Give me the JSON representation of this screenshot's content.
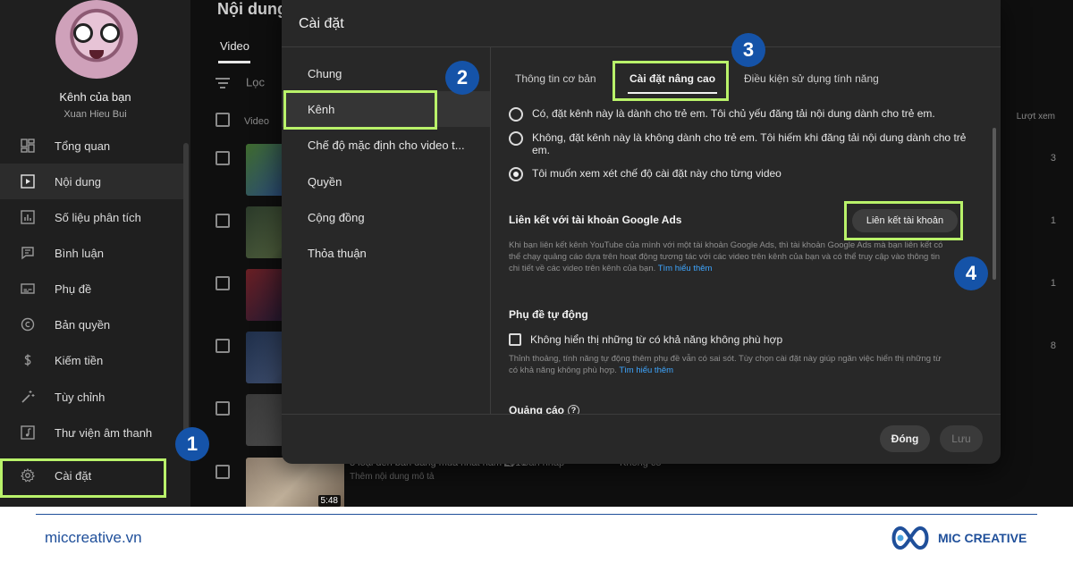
{
  "sidebar": {
    "channel_name": "Kênh của bạn",
    "channel_handle": "Xuan Hieu Bui",
    "items": [
      {
        "label": "Tổng quan",
        "icon": "dashboard-icon"
      },
      {
        "label": "Nội dung",
        "icon": "content-icon"
      },
      {
        "label": "Số liệu phân tích",
        "icon": "analytics-icon"
      },
      {
        "label": "Bình luận",
        "icon": "comments-icon"
      },
      {
        "label": "Phụ đề",
        "icon": "subtitles-icon"
      },
      {
        "label": "Bản quyền",
        "icon": "copyright-icon"
      },
      {
        "label": "Kiếm tiền",
        "icon": "dollar-icon"
      },
      {
        "label": "Tùy chỉnh",
        "icon": "magic-wand-icon"
      },
      {
        "label": "Thư viện âm thanh",
        "icon": "audio-library-icon"
      },
      {
        "label": "Cài đặt",
        "icon": "gear-icon"
      }
    ]
  },
  "content": {
    "title": "Nội dung",
    "tab": "Video",
    "filter_placeholder": "Lọc",
    "header_video": "Video",
    "header_views": "Lượt xem",
    "rows": [
      {
        "views": "3"
      },
      {
        "views": "1"
      },
      {
        "views": "1"
      },
      {
        "views": "8"
      },
      {
        "views": ""
      },
      {
        "title": "8 loại đèn bàn đáng mua nhất năm 2019",
        "description": "Thêm nội dung mô tả",
        "status": "Bản nháp",
        "restriction": "Không có",
        "duration": "5:48"
      }
    ]
  },
  "dialog": {
    "title": "Cài đặt",
    "menu": [
      "Chung",
      "Kênh",
      "Chế độ mặc định cho video t...",
      "Quyền",
      "Cộng đồng",
      "Thỏa thuận"
    ],
    "tabs": [
      "Thông tin cơ bản",
      "Cài đặt nâng cao",
      "Điều kiện sử dụng tính năng"
    ],
    "audience": {
      "options": [
        "Có, đặt kênh này là dành cho trẻ em. Tôi chủ yếu đăng tải nội dung dành cho trẻ em.",
        "Không, đặt kênh này là không dành cho trẻ em. Tôi hiếm khi đăng tải nội dung dành cho trẻ em.",
        "Tôi muốn xem xét chế độ cài đặt này cho từng video"
      ],
      "selected_index": 2
    },
    "google_ads": {
      "title": "Liên kết với tài khoản Google Ads",
      "button": "Liên kết tài khoản",
      "description": "Khi bạn liên kết kênh YouTube của mình với một tài khoản Google Ads, thì tài khoản Google Ads mà bạn liên kết có thể chạy quảng cáo dựa trên hoạt động tương tác với các video trên kênh của bạn và có thể truy cập vào thông tin chi tiết về các video trên kênh của bạn.",
      "learn_more": "Tìm hiểu thêm"
    },
    "auto_captions": {
      "title": "Phụ đề tự động",
      "checkbox_label": "Không hiển thị những từ có khả năng không phù hợp",
      "checked": false,
      "description": "Thỉnh thoảng, tính năng tự động thêm phụ đề vẫn có sai sót. Tùy chọn cài đặt này giúp ngăn việc hiển thị những từ có khả năng không phù hợp.",
      "learn_more": "Tìm hiểu thêm"
    },
    "ads_section": {
      "title": "Quảng cáo",
      "help": "?"
    },
    "close_button": "Đóng",
    "save_button": "Lưu"
  },
  "annotations": {
    "badges": [
      "1",
      "2",
      "3",
      "4"
    ],
    "highlight_color": "#b9f26a",
    "badge_color": "#1553a8"
  },
  "footer": {
    "website": "miccreative.vn",
    "brand": "MIC CREATIVE"
  }
}
